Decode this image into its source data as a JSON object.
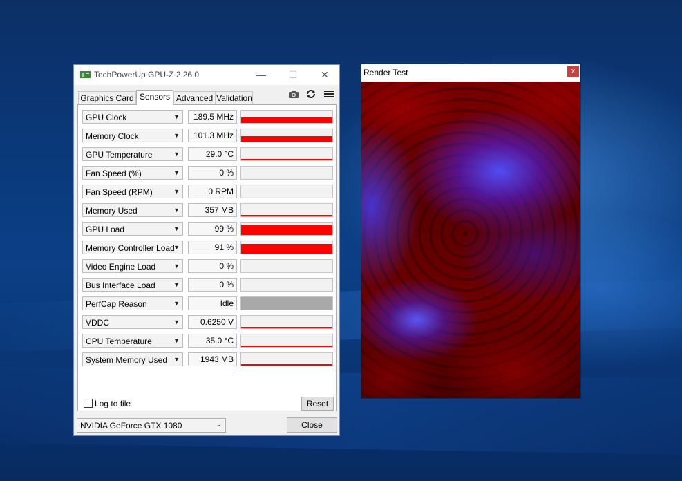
{
  "gpuz": {
    "title": "TechPowerUp GPU-Z 2.26.0",
    "window_buttons": {
      "minimize": "—",
      "maximize": "☐",
      "close": "✕"
    },
    "tabs": [
      {
        "label": "Graphics Card",
        "active": false
      },
      {
        "label": "Sensors",
        "active": true
      },
      {
        "label": "Advanced",
        "active": false
      },
      {
        "label": "Validation",
        "active": false
      }
    ],
    "toolbar_icons": [
      "camera-icon",
      "refresh-icon",
      "menu-icon"
    ],
    "sensors": [
      {
        "name": "GPU Clock",
        "value": "189.5 MHz",
        "level": 0.45,
        "color": "#ff0000"
      },
      {
        "name": "Memory Clock",
        "value": "101.3 MHz",
        "level": 0.45,
        "color": "#ff0000"
      },
      {
        "name": "GPU Temperature",
        "value": "29.0 °C",
        "level": 0.05,
        "color": "#ff0000"
      },
      {
        "name": "Fan Speed (%)",
        "value": "0 %",
        "level": 0,
        "color": "#ff0000"
      },
      {
        "name": "Fan Speed (RPM)",
        "value": "0 RPM",
        "level": 0,
        "color": "#ff0000"
      },
      {
        "name": "Memory Used",
        "value": "357 MB",
        "level": 0.05,
        "color": "#ff0000"
      },
      {
        "name": "GPU Load",
        "value": "99 %",
        "level": 0.85,
        "color": "#ff0000"
      },
      {
        "name": "Memory Controller Load",
        "value": "91 %",
        "level": 0.78,
        "color": "#ff0000"
      },
      {
        "name": "Video Engine Load",
        "value": "0 %",
        "level": 0,
        "color": "#ff0000"
      },
      {
        "name": "Bus Interface Load",
        "value": "0 %",
        "level": 0,
        "color": "#ff0000"
      },
      {
        "name": "PerfCap Reason",
        "value": "Idle",
        "level": 1.0,
        "color": "#a9a9a9"
      },
      {
        "name": "VDDC",
        "value": "0.6250 V",
        "level": 0.05,
        "color": "#ff0000"
      },
      {
        "name": "CPU Temperature",
        "value": "35.0 °C",
        "level": 0.05,
        "color": "#ff0000"
      },
      {
        "name": "System Memory Used",
        "value": "1943 MB",
        "level": 0.05,
        "color": "#ff0000"
      }
    ],
    "log_to_file": {
      "label": "Log to file",
      "checked": false
    },
    "reset_label": "Reset",
    "gpu_select": {
      "value": "NVIDIA GeForce GTX 1080"
    },
    "close_label": "Close"
  },
  "render_test": {
    "title": "Render Test",
    "close_symbol": "x"
  }
}
